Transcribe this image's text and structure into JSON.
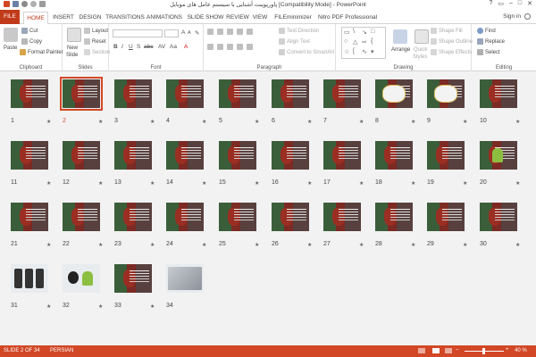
{
  "window": {
    "title": "پاورپوینت آشنایی با سیستم عامل های موبایل [Compatibility Mode] - PowerPoint",
    "controls": [
      "?",
      "▭",
      "–",
      "□",
      "✕"
    ]
  },
  "tabs": [
    {
      "label": "FILE",
      "kind": "file"
    },
    {
      "label": "HOME",
      "kind": "active"
    },
    {
      "label": "INSERT"
    },
    {
      "label": "DESIGN"
    },
    {
      "label": "TRANSITIONS"
    },
    {
      "label": "ANIMATIONS"
    },
    {
      "label": "SLIDE SHOW"
    },
    {
      "label": "REVIEW"
    },
    {
      "label": "VIEW"
    },
    {
      "label": "FILEminimizer"
    },
    {
      "label": "Nitro PDF Professional"
    }
  ],
  "sign_in": "Sign in",
  "ribbon": {
    "clipboard": {
      "label": "Clipboard",
      "paste": "Paste",
      "cut": "Cut",
      "copy": "Copy",
      "format_painter": "Format Painter"
    },
    "slides": {
      "label": "Slides",
      "new_slide": "New",
      "new_slide_2": "Slide",
      "layout": "Layout",
      "reset": "Reset",
      "section": "Section"
    },
    "font": {
      "label": "Font"
    },
    "paragraph": {
      "label": "Paragraph",
      "text_direction": "Text Direction",
      "align_text": "Align Text",
      "convert_smartart": "Convert to SmartArt"
    },
    "drawing": {
      "label": "Drawing",
      "arrange": "Arrange",
      "quick_styles": "Quick",
      "quick_styles_2": "Styles",
      "shape_fill": "Shape Fill",
      "shape_outline": "Shape Outline",
      "shape_effects": "Shape Effects"
    },
    "editing": {
      "label": "Editing",
      "find": "Find",
      "replace": "Replace",
      "select": "Select"
    }
  },
  "slides": [
    {
      "n": "1",
      "star": "★",
      "style": "dark"
    },
    {
      "n": "2",
      "star": "★",
      "style": "dark",
      "selected": true
    },
    {
      "n": "3",
      "star": "★",
      "style": "dark"
    },
    {
      "n": "4",
      "star": "★",
      "style": "dark"
    },
    {
      "n": "5",
      "star": "★",
      "style": "dark"
    },
    {
      "n": "6",
      "star": "★",
      "style": "dark"
    },
    {
      "n": "7",
      "star": "★",
      "style": "dark"
    },
    {
      "n": "8",
      "star": "★",
      "style": "diagram"
    },
    {
      "n": "9",
      "star": "★",
      "style": "diagram"
    },
    {
      "n": "10",
      "star": "★",
      "style": "dark"
    },
    {
      "n": "11",
      "star": "★",
      "style": "dark"
    },
    {
      "n": "12",
      "star": "★",
      "style": "dark"
    },
    {
      "n": "13",
      "star": "★",
      "style": "dark"
    },
    {
      "n": "14",
      "star": "★",
      "style": "dark"
    },
    {
      "n": "15",
      "star": "★",
      "style": "dark"
    },
    {
      "n": "16",
      "star": "★",
      "style": "dark"
    },
    {
      "n": "17",
      "star": "★",
      "style": "dark"
    },
    {
      "n": "18",
      "star": "★",
      "style": "dark"
    },
    {
      "n": "19",
      "star": "★",
      "style": "dark"
    },
    {
      "n": "20",
      "star": "★",
      "style": "android"
    },
    {
      "n": "21",
      "star": "★",
      "style": "dark"
    },
    {
      "n": "22",
      "star": "★",
      "style": "dark"
    },
    {
      "n": "23",
      "star": "★",
      "style": "dark"
    },
    {
      "n": "24",
      "star": "★",
      "style": "dark"
    },
    {
      "n": "25",
      "star": "★",
      "style": "dark"
    },
    {
      "n": "26",
      "star": "★",
      "style": "dark"
    },
    {
      "n": "27",
      "star": "★",
      "style": "dark"
    },
    {
      "n": "28",
      "star": "★",
      "style": "dark"
    },
    {
      "n": "29",
      "star": "★",
      "style": "dark"
    },
    {
      "n": "30",
      "star": "★",
      "style": "dark"
    },
    {
      "n": "31",
      "star": "★",
      "style": "phones"
    },
    {
      "n": "32",
      "star": "★",
      "style": "logos"
    },
    {
      "n": "33",
      "star": "★",
      "style": "dark"
    },
    {
      "n": "34",
      "star": "",
      "style": "photo"
    }
  ],
  "status": {
    "slide_of": "SLIDE 2 OF 34",
    "language": "PERSIAN",
    "zoom_minus": "–",
    "zoom_plus": "+",
    "zoom": "40 %"
  },
  "colors": {
    "accent": "#d24726",
    "file_tab": "#c13b1b"
  }
}
